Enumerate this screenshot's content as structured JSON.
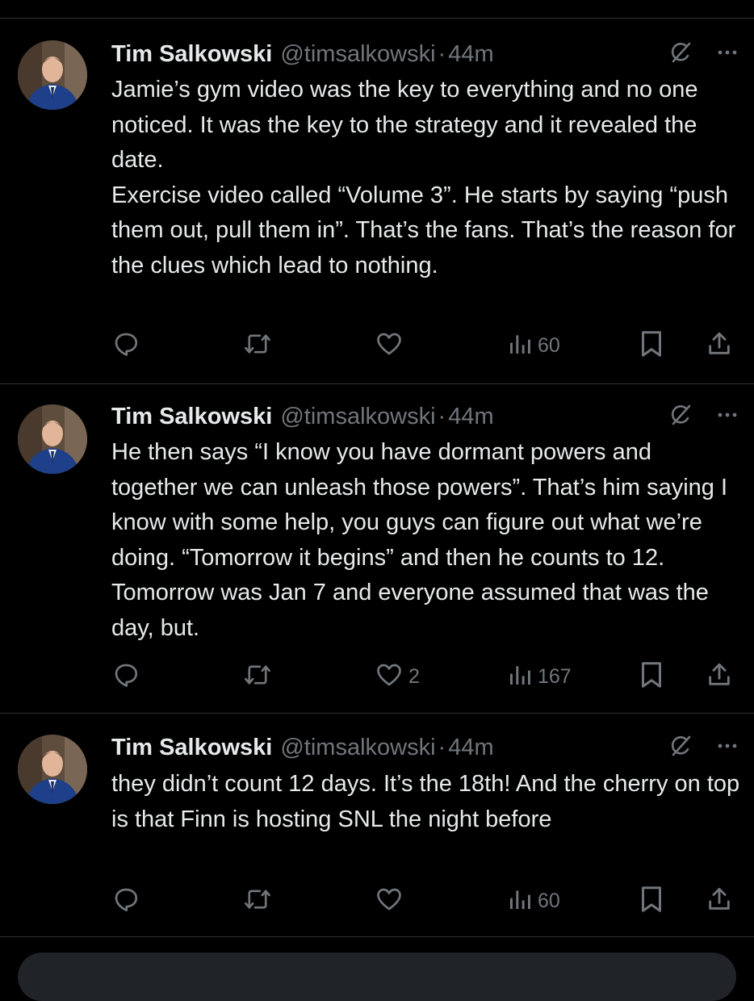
{
  "tweets": [
    {
      "author_name": "Tim Salkowski",
      "handle": "@timsalkowski",
      "separator": "·",
      "time": "44m",
      "text": "Jamie’s gym video was the key to everything and no one noticed. It was the key to the strategy and it revealed the date.\nExercise video called “Volume 3”.  He starts by saying “push them out, pull them in”. That’s the fans. That’s the reason for the clues which lead to nothing.",
      "likes": "",
      "views": "60"
    },
    {
      "author_name": "Tim Salkowski",
      "handle": "@timsalkowski",
      "separator": "·",
      "time": "44m",
      "text": "He then says “I know you have dormant powers and together we can unleash those powers”. That’s him saying I know with some help, you guys can figure out what we’re doing. “Tomorrow it begins” and then he counts to 12. Tomorrow was Jan 7 and everyone assumed that was the day, but.",
      "likes": "2",
      "views": "167"
    },
    {
      "author_name": "Tim Salkowski",
      "handle": "@timsalkowski",
      "separator": "·",
      "time": "44m",
      "text": "they didn’t count 12 days. It’s the 18th! And the cherry on top is that Finn is hosting SNL the night before",
      "likes": "",
      "views": "60"
    }
  ],
  "icons": {
    "grok": "grok-icon",
    "more": "more-icon",
    "reply": "reply-icon",
    "retweet": "retweet-icon",
    "like": "heart-icon",
    "views": "views-icon",
    "bookmark": "bookmark-icon",
    "share": "share-icon"
  },
  "colors": {
    "background": "#000000",
    "text": "#e7e9ea",
    "secondary": "#71767b",
    "divider": "#2f3336"
  }
}
